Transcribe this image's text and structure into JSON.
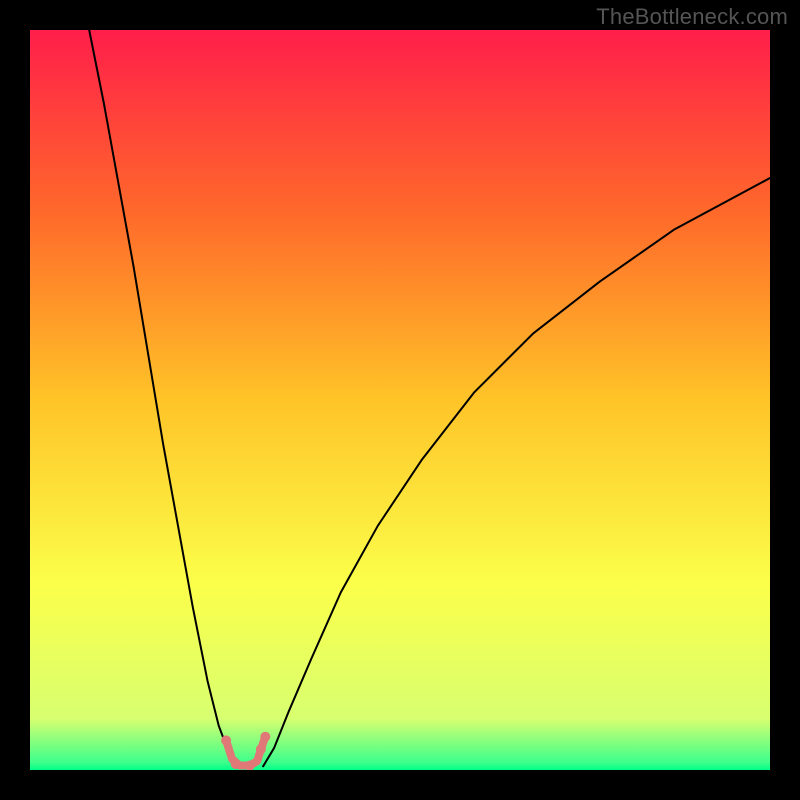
{
  "watermark": "TheBottleneck.com",
  "chart_data": {
    "type": "line",
    "title": "",
    "xlabel": "",
    "ylabel": "",
    "xlim": [
      0,
      100
    ],
    "ylim": [
      0,
      100
    ],
    "grid": false,
    "legend": false,
    "background_gradient": {
      "stops": [
        {
          "offset": 0.0,
          "color": "#ff1e4a"
        },
        {
          "offset": 0.25,
          "color": "#ff6a2a"
        },
        {
          "offset": 0.5,
          "color": "#ffc428"
        },
        {
          "offset": 0.75,
          "color": "#fbff4a"
        },
        {
          "offset": 0.93,
          "color": "#d8ff70"
        },
        {
          "offset": 0.99,
          "color": "#3cff8c"
        },
        {
          "offset": 1.0,
          "color": "#00ff88"
        }
      ]
    },
    "series": [
      {
        "name": "curve-left",
        "stroke": "#000000",
        "x": [
          8,
          10,
          12,
          14,
          16,
          18,
          20,
          22,
          24,
          25.5,
          27,
          27.8
        ],
        "y": [
          100,
          90,
          79,
          68,
          56,
          44,
          33,
          22,
          12,
          6,
          2,
          0.5
        ]
      },
      {
        "name": "curve-right",
        "stroke": "#000000",
        "x": [
          31.5,
          33,
          35,
          38,
          42,
          47,
          53,
          60,
          68,
          77,
          87,
          100
        ],
        "y": [
          0.5,
          3,
          8,
          15,
          24,
          33,
          42,
          51,
          59,
          66,
          73,
          80
        ]
      },
      {
        "name": "trough",
        "stroke": "#e07878",
        "stroke_width": 8,
        "x": [
          26.5,
          27.3,
          28.3,
          29.7,
          30.7,
          31.2,
          31.8
        ],
        "y": [
          4.0,
          1.5,
          0.6,
          0.6,
          1.2,
          2.8,
          4.5
        ]
      }
    ],
    "markers": [
      {
        "x": 26.5,
        "y": 4.0,
        "r": 5,
        "fill": "#e07878"
      },
      {
        "x": 27.8,
        "y": 0.8,
        "r": 5,
        "fill": "#e07878"
      },
      {
        "x": 29.7,
        "y": 0.6,
        "r": 5,
        "fill": "#e07878"
      },
      {
        "x": 31.2,
        "y": 2.8,
        "r": 5,
        "fill": "#e07878"
      },
      {
        "x": 31.8,
        "y": 4.5,
        "r": 5,
        "fill": "#e07878"
      }
    ]
  }
}
